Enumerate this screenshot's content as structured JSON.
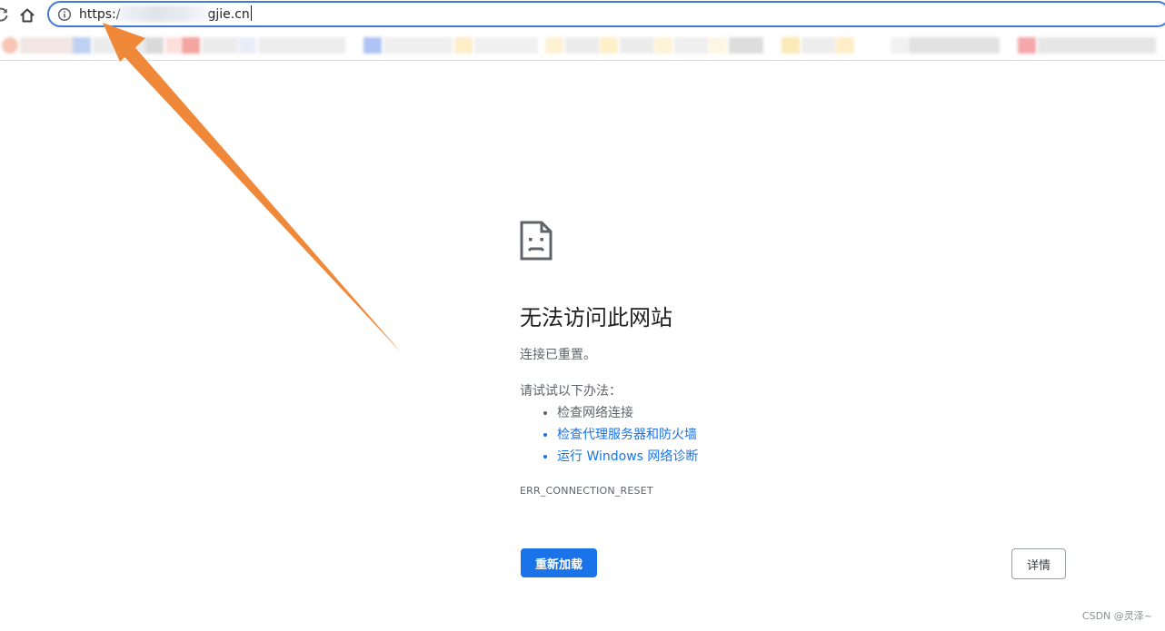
{
  "browser": {
    "address_bar": {
      "url_prefix": "https:/",
      "url_suffix": "gjie.cn"
    }
  },
  "error_page": {
    "title": "无法访问此网站",
    "summary": "连接已重置。",
    "try_heading": "请试试以下办法：",
    "suggestions": [
      "检查网络连接",
      "检查代理服务器和防火墙",
      "运行 Windows 网络诊断"
    ],
    "error_code": "ERR_CONNECTION_RESET",
    "reload_label": "重新加载",
    "details_label": "详情"
  },
  "watermark": "CSDN @灵泽~",
  "colors": {
    "accent": "#1a73e8",
    "annotation_arrow": "#f0883a",
    "omnibox_border": "#3e7bd6"
  },
  "icons": {
    "reload": "reload-icon",
    "home": "home-icon",
    "info": "info-icon",
    "error": "sad-page-icon"
  }
}
